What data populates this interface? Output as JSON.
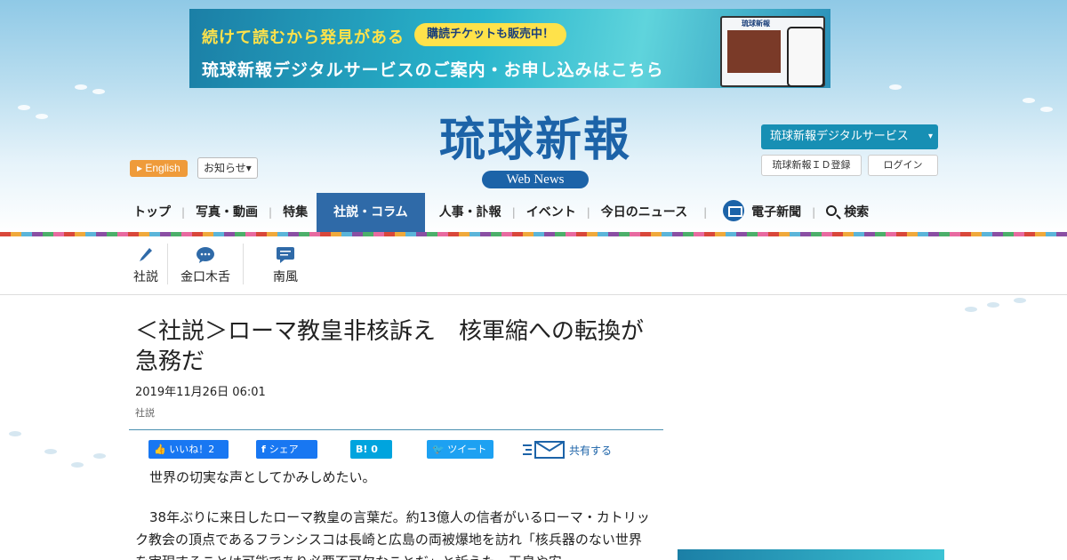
{
  "banner": {
    "line1": "続けて読むから発見がある",
    "pill": "購読チケットも販売中！",
    "line2": "琉球新報デジタルサービスのご案内・お申し込みはこちら",
    "device_title": "琉球新報"
  },
  "logo": {
    "title": "琉球新報",
    "subtitle": "Web News"
  },
  "header": {
    "english": "English",
    "notice": "お知らせ",
    "digital_service": "琉球新報デジタルサービス",
    "id_register": "琉球新報ＩＤ登録",
    "login": "ログイン"
  },
  "nav": {
    "top": "トップ",
    "photo_video": "写真・動画",
    "feature": "特集",
    "editorial_column": "社説・コラム",
    "personnel": "人事・訃報",
    "event": "イベント",
    "today_news": "今日のニュース",
    "e_paper": "電子新聞",
    "search": "検索"
  },
  "subnav": {
    "editorial": "社説",
    "kinkuchi": "金口木舌",
    "nanpu": "南風"
  },
  "article": {
    "title": "＜社説＞ローマ教皇非核訴え　核軍縮への転換が急務だ",
    "date": "2019年11月26日 06:01",
    "category": "社説",
    "paragraph1": "世界の切実な声としてかみしめたい。",
    "paragraph2": "38年ぶりに来日したローマ教皇の言葉だ。約13億人の信者がいるローマ・カトリック教会の頂点であるフランシスコは長崎と広島の両被爆地を訪れ「核兵器のない世界を実現することは可能であり必要不可欠なことだ」と訴えた。天皇や安"
  },
  "share": {
    "like": "いいね！2",
    "facebook": "シェア",
    "hatena": "0",
    "twitter": "ツイート",
    "mail": "共有する"
  },
  "colors": {
    "brand_blue": "#1c63a8",
    "nav_active": "#2f6aa8",
    "english_orange": "#ef9b3a",
    "digital_button": "#178fb4"
  }
}
